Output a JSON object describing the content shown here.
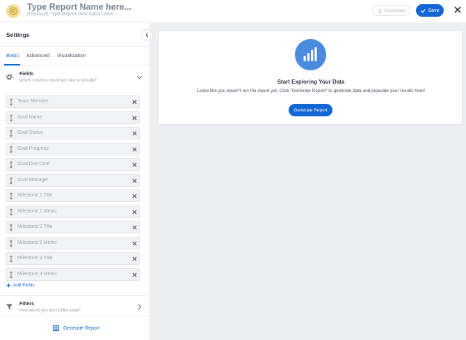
{
  "header": {
    "logo_icon": "target-icon",
    "report_name_placeholder": "Type Report Name here...",
    "report_description_placeholder": "(Optional) Type Report Description here...",
    "download_label": "Download",
    "save_label": "Save",
    "close_icon": "close-icon",
    "accent_color": "#1266d4"
  },
  "sidebar": {
    "title": "Settings",
    "tabs": [
      {
        "label": "Basic",
        "active": true
      },
      {
        "label": "Advanced",
        "active": false
      },
      {
        "label": "Visualization",
        "active": false
      }
    ],
    "fields_section": {
      "title": "Fields",
      "subtitle": "Which columns would you like to include?",
      "icon": "gear-icon",
      "expanded": true
    },
    "fields": [
      "Team Member",
      "Goal Name",
      "Goal Status",
      "Goal Progress",
      "Goal Due Date",
      "Goal Manager",
      "Milestone 1 Title",
      "Milestone 1 Metric",
      "Milestone 2 Title",
      "Milestone 2 Metric",
      "Milestone 3 Title",
      "Milestone 3 Metric"
    ],
    "add_fields_label": "Add Fields",
    "filters_section": {
      "title": "Filters",
      "subtitle": "How would you like to filter data?",
      "icon": "filter-icon",
      "expanded": false
    },
    "generate_label": "Generate Report"
  },
  "main": {
    "empty_state": {
      "icon": "bar-chart-icon",
      "title": "Start Exploring Your Data",
      "text": "Looks like you haven't run the report yet. Click \"Generate Report\" to generate data and populate your results here!",
      "button_label": "Generate Report"
    }
  }
}
